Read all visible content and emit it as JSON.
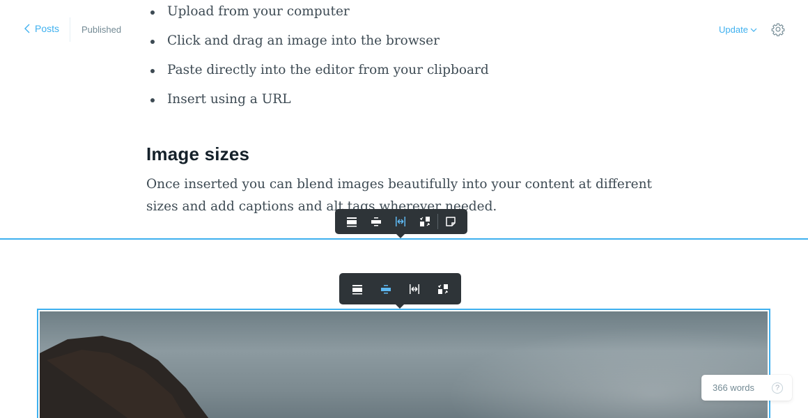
{
  "header": {
    "back_label": "Posts",
    "status": "Published",
    "update_label": "Update"
  },
  "content": {
    "bullets": [
      "Upload from your computer",
      "Click and drag an image into the browser",
      "Paste directly into the editor from your clipboard",
      "Insert using a URL"
    ],
    "heading": "Image sizes",
    "paragraph": "Once inserted you can blend images beautifully into your content at different sizes and add captions and alt tags wherever needed."
  },
  "toolbar_primary": {
    "buttons": [
      "width-regular-icon",
      "width-wide-icon",
      "width-full-icon",
      "replace-image-icon",
      "snippet-icon"
    ],
    "active": "width-full-icon"
  },
  "toolbar_card": {
    "buttons": [
      "width-regular-icon",
      "width-wide-icon",
      "width-full-icon",
      "replace-image-icon"
    ],
    "active": "width-wide-icon"
  },
  "footer": {
    "word_count": "366 words",
    "help_label": "?"
  },
  "colors": {
    "accent": "#3eb0ef",
    "toolbar_bg": "#2e3438",
    "text": "#3d4a53"
  }
}
